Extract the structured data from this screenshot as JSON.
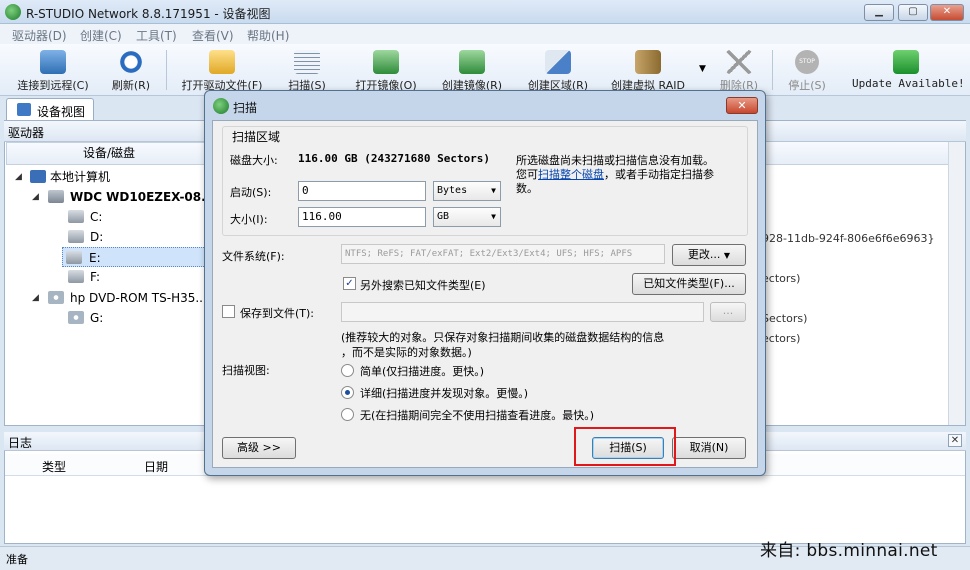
{
  "window": {
    "title": "R-STUDIO Network 8.8.171951 - 设备视图",
    "min": "▁",
    "max": "▢",
    "close": "✕"
  },
  "menu": [
    "驱动器(D)",
    "创建(C)",
    "工具(T)",
    "查看(V)",
    "帮助(H)"
  ],
  "toolbar": {
    "connect": "连接到远程(C)",
    "refresh": "刷新(R)",
    "open_files": "打开驱动文件(F)",
    "scan": "扫描(S)",
    "open_image": "打开镜像(O)",
    "create_image": "创建镜像(R)",
    "create_region": "创建区域(R)",
    "create_raid": "创建虚拟 RAID",
    "delete": "删除(R)",
    "stop": "停止(S)",
    "update": "Update Available!",
    "stop_icon_text": "STOP"
  },
  "tabs": {
    "device_view": "设备视图"
  },
  "drives_panel": {
    "title": "驱动器",
    "column": "设备/磁盘",
    "tree": [
      {
        "label": "本地计算机",
        "level": 1
      },
      {
        "label": "WDC WD10EZEX-08...",
        "level": 2
      },
      {
        "label": "C:",
        "level": 3
      },
      {
        "label": "D:",
        "level": 3
      },
      {
        "label": "E:",
        "level": 3
      },
      {
        "label": "F:",
        "level": 3
      },
      {
        "label": "hp DVD-ROM TS-H35...",
        "level": 2
      },
      {
        "label": "G:",
        "level": 3
      }
    ],
    "right_fragments": [
      "928-11db-924f-806e6f6e6963}",
      "ectors)",
      "Sectors)",
      "ectors)"
    ]
  },
  "log_panel": {
    "title": "日志",
    "columns": [
      "类型",
      "日期"
    ],
    "close": "✕"
  },
  "status": "准备",
  "watermark": "来自: bbs.minnai.net",
  "dialog": {
    "title": "扫描",
    "close": "✕",
    "area_group": "扫描区域",
    "disk_size_label": "磁盘大小:",
    "disk_size_value": "116.00 GB (243271680 Sectors)",
    "info_text_1": "所选磁盘尚未扫描或扫描信息没有加载。",
    "info_text_2a": "您可",
    "info_link": "扫描整个磁盘",
    "info_text_2b": "，或者手动指定扫描参",
    "info_text_3": "数。",
    "start_label": "启动(S):",
    "start_value": "0",
    "start_unit": "Bytes",
    "size_label": "大小(I):",
    "size_value": "116.00",
    "size_unit": "GB",
    "fs_label": "文件系统(F):",
    "fs_value": "NTFS; ReFS; FAT/exFAT; Ext2/Ext3/Ext4; UFS; HFS; APFS",
    "fs_change": "更改...",
    "extra_search_label": "另外搜索已知文件类型(E)",
    "known_types_btn": "已知文件类型(F)...",
    "save_to_file_label": "保存到文件(T):",
    "save_browse": "...",
    "save_note_1": "(推荐较大的对象。只保存对象扫描期间收集的磁盘数据结构的信息",
    "save_note_2": "，而不是实际的对象数据。)",
    "view_label": "扫描视图:",
    "view_simple": "简单(仅扫描进度。更快。)",
    "view_detail": "详细(扫描进度并发现对象。更慢。)",
    "view_none": "无(在扫描期间完全不使用扫描查看进度。最快。)",
    "advanced_btn": "高级 >>",
    "scan_btn": "扫描(S)",
    "cancel_btn": "取消(N)",
    "check_mark": "✓"
  },
  "colors": {
    "accent": "#3c7fb1",
    "highlight": "#e0171b"
  }
}
